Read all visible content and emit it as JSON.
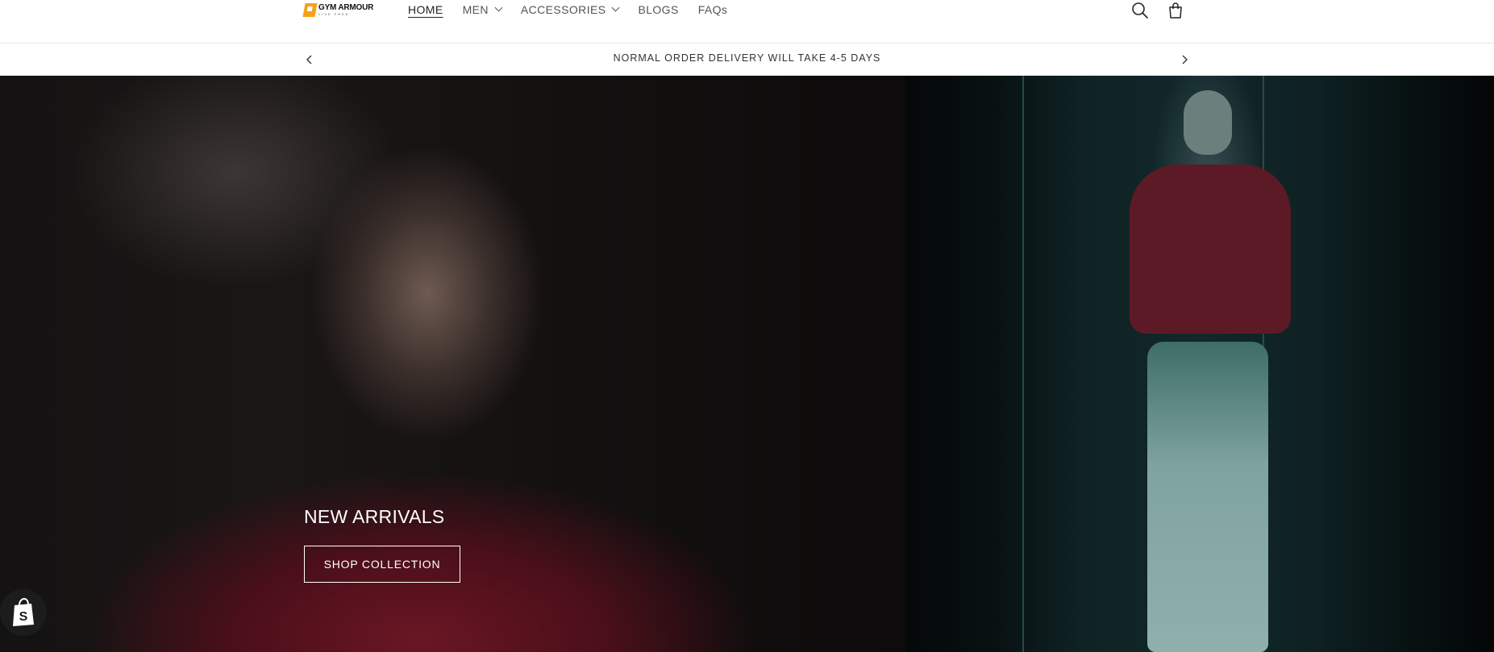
{
  "brand": {
    "name": "GYM ARMOUR",
    "tagline": "LIVE FREE",
    "accent": "#f5a21b"
  },
  "nav": {
    "items": [
      {
        "label": "HOME",
        "active": true,
        "dropdown": false
      },
      {
        "label": "MEN",
        "active": false,
        "dropdown": true
      },
      {
        "label": "ACCESSORIES",
        "active": false,
        "dropdown": true
      },
      {
        "label": "BLOGS",
        "active": false,
        "dropdown": false
      },
      {
        "label": "FAQs",
        "active": false,
        "dropdown": false
      }
    ]
  },
  "header_icons": [
    "search-icon",
    "cart-icon"
  ],
  "announcement": {
    "text": "NORMAL ORDER DELIVERY WILL TAKE 4-5 DAYS",
    "prev_icon": "chevron-left-icon",
    "next_icon": "chevron-right-icon"
  },
  "hero": {
    "title": "NEW ARRIVALS",
    "button_label": "SHOP COLLECTION",
    "shirt_color": "#5c1a26"
  },
  "floating": {
    "icon": "shopify-bag-icon"
  }
}
